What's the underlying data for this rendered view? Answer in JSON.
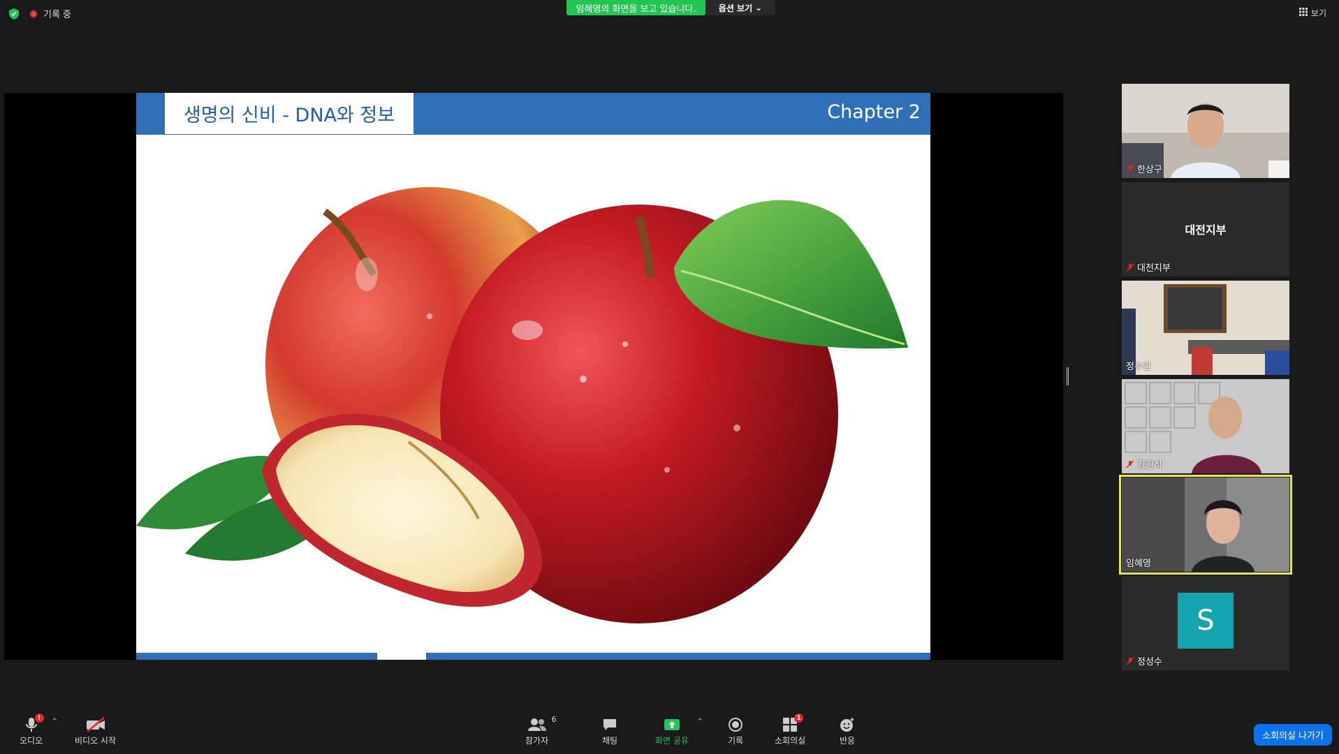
{
  "top": {
    "recording_label": "기록 중",
    "sharing_banner": "임혜영의 화면을 보고 있습니다.",
    "view_options": "옵션 보기",
    "view_button": "보기"
  },
  "slide": {
    "title": "생명의 신비 - DNA와 정보",
    "chapter": "Chapter 2"
  },
  "participants": [
    {
      "name": "한상구",
      "muted": true,
      "video": true
    },
    {
      "name": "대전지부",
      "display_name": "대전지부",
      "muted": true,
      "video": false
    },
    {
      "name": "정수연",
      "muted": false,
      "video": true
    },
    {
      "name": "김원석",
      "muted": true,
      "video": true
    },
    {
      "name": "임혜영",
      "muted": false,
      "video": true,
      "active_speaker": true
    },
    {
      "name": "정성수",
      "avatar_letter": "S",
      "muted": true,
      "video": false
    }
  ],
  "toolbar": {
    "audio": "오디오",
    "audio_badge": "!",
    "video": "비디오 시작",
    "participants": "참가자",
    "participants_count": "6",
    "chat": "채팅",
    "share": "화면 공유",
    "record": "기록",
    "breakout": "소회의실",
    "breakout_badge": "1",
    "reactions": "반응",
    "leave": "소회의실 나가기"
  },
  "colors": {
    "share_green": "#23c552",
    "slide_blue": "#2f6fb5",
    "active_outline": "#e9e74a",
    "avatar_teal": "#13a4b0",
    "leave_blue": "#0e72ed"
  }
}
